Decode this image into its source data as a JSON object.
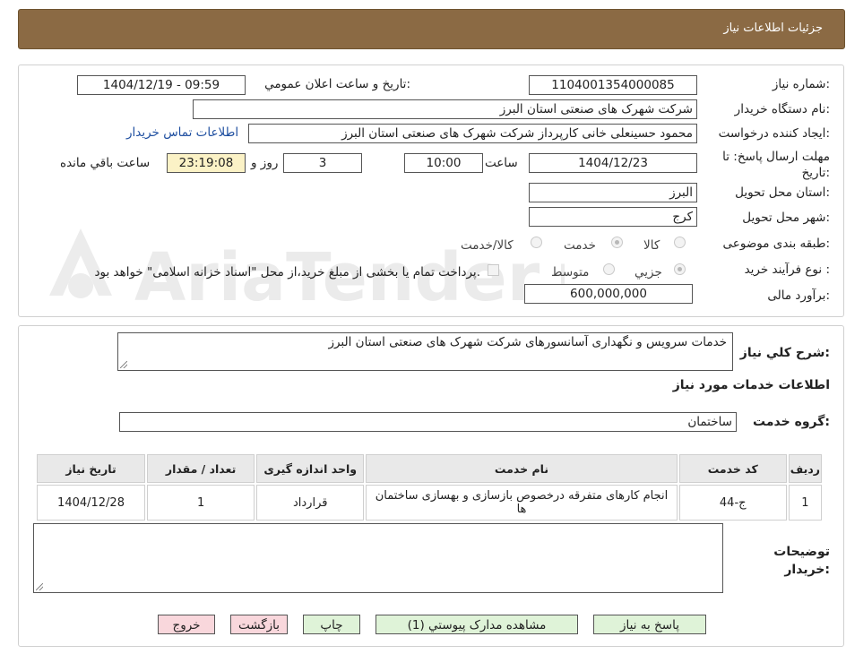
{
  "header": {
    "title": "جزئيات اطلاعات نياز"
  },
  "form": {
    "need_number_label": "شماره نياز:",
    "need_number": "1104001354000085",
    "announce_label": "تاريخ و ساعت اعلان عمومي:",
    "announce_value": "1404/12/19 - 09:59",
    "buyer_org_label": "نام دستگاه خريدار:",
    "buyer_org": "شركت شهرک های صنعتی استان البرز",
    "creator_label": "ايجاد کننده درخواست:",
    "creator": "محمود حسینعلی خانی کارپرداز شرکت شهرک های صنعتی استان البرز",
    "contact_link": "اطلاعات تماس خريدار",
    "deadline_label": "مهلت ارسال پاسخ: تا تاريخ:",
    "deadline_date": "1404/12/23",
    "hour_label": "ساعت",
    "deadline_time": "10:00",
    "days_value": "3",
    "days_label": "روز و",
    "remaining_time": "23:19:08",
    "remaining_label": "ساعت باقي مانده",
    "province_label": "استان محل تحويل:",
    "province": "البرز",
    "city_label": "شهر محل تحويل:",
    "city": "کرج",
    "category_label": "طبقه بندی موضوعی:",
    "category_options": [
      "کالا",
      "خدمت",
      "کالا/خدمت"
    ],
    "category_selected": "خدمت",
    "process_label": "نوع فرآیند خرید :",
    "process_options": [
      "جزيي",
      "متوسط"
    ],
    "process_selected": "جزيي",
    "payment_note": "پرداخت تمام یا بخشی از مبلغ خرید،از محل \"اسناد خزانه اسلامی\" خواهد بود.",
    "budget_label": "برآورد مالی:",
    "budget": "600,000,000"
  },
  "description": {
    "label": "شرح كلي نياز:",
    "value": "خدمات سرویس و نگهداری آسانسورهای شرکت شهرک های صنعتی استان البرز"
  },
  "services": {
    "section_title": "اطلاعات خدمات مورد نياز",
    "group_label": "گروه خدمت:",
    "group_value": "ساختمان",
    "columns": [
      "رديف",
      "کد خدمت",
      "نام خدمت",
      "واحد اندازه گيری",
      "تعداد / مقدار",
      "تاريخ نياز"
    ],
    "rows": [
      [
        "1",
        "ج-44",
        "انجام کارهای متفرقه درخصوص بازسازی و بهسازی ساختمان ها",
        "قرارداد",
        "1",
        "1404/12/28"
      ]
    ]
  },
  "buyer_notes": {
    "label": "توضيحات خريدار:",
    "value": ""
  },
  "buttons": {
    "reply": "پاسخ به نياز",
    "attachments": "مشاهده مدارک پيوستي (1)",
    "print": "چاپ",
    "back": "بازگشت",
    "exit": "خروج"
  },
  "watermark": {
    "text": "AriaTender.neT"
  },
  "colors": {
    "header": "#8b6a44",
    "link": "#1f4fa0",
    "remaining_bg": "#fbf2c6",
    "green_btn": "#dff3d8",
    "pink_btn": "#f9d7dc"
  }
}
